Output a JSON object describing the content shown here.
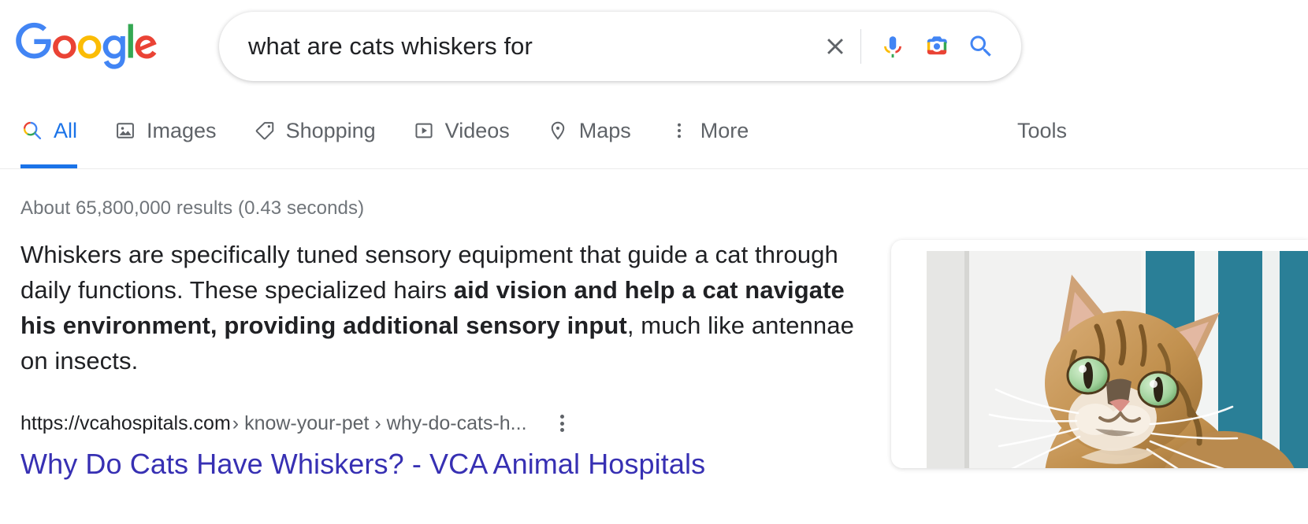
{
  "brand": {
    "logo_name": "Google",
    "logo_letters": [
      "G",
      "o",
      "o",
      "g",
      "l",
      "e"
    ],
    "logo_colors": [
      "#4285F4",
      "#EA4335",
      "#FBBC05",
      "#4285F4",
      "#34A853",
      "#EA4335"
    ]
  },
  "search": {
    "query": "what are cats whiskers for",
    "placeholder": "Search",
    "clear_label": "Clear",
    "voice_label": "Search by voice",
    "lens_label": "Search by image",
    "submit_label": "Google Search"
  },
  "nav": {
    "tabs": [
      {
        "label": "All",
        "icon": "search-icon",
        "active": true
      },
      {
        "label": "Images",
        "icon": "image-icon",
        "active": false
      },
      {
        "label": "Shopping",
        "icon": "tag-icon",
        "active": false
      },
      {
        "label": "Videos",
        "icon": "video-icon",
        "active": false
      },
      {
        "label": "Maps",
        "icon": "map-pin-icon",
        "active": false
      },
      {
        "label": "More",
        "icon": "more-vertical-icon",
        "active": false
      }
    ],
    "tools_label": "Tools"
  },
  "results": {
    "stats": "About 65,800,000 results (0.43 seconds)",
    "featured_snippet": {
      "part1": "Whiskers are specifically tuned sensory equipment that guide a cat through daily functions. These specialized hairs ",
      "bold": "aid vision and help a cat navigate his environment, providing additional sensory input",
      "part2": ", much like antennae on insects."
    },
    "source": {
      "url_domain": "https://vcahospitals.com",
      "url_path": "› know-your-pet › why-do-cats-h...",
      "title": "Why Do Cats Have Whiskers? - VCA Animal Hospitals",
      "thumbnail_alt": "Tabby cat with green eyes looking upward in front of a white and teal striped background"
    }
  },
  "colors": {
    "link_visited": "#3730b3",
    "accent_blue": "#1a73e8",
    "text_primary": "#202124",
    "text_secondary": "#5f6368",
    "stats_gray": "#70757a"
  }
}
